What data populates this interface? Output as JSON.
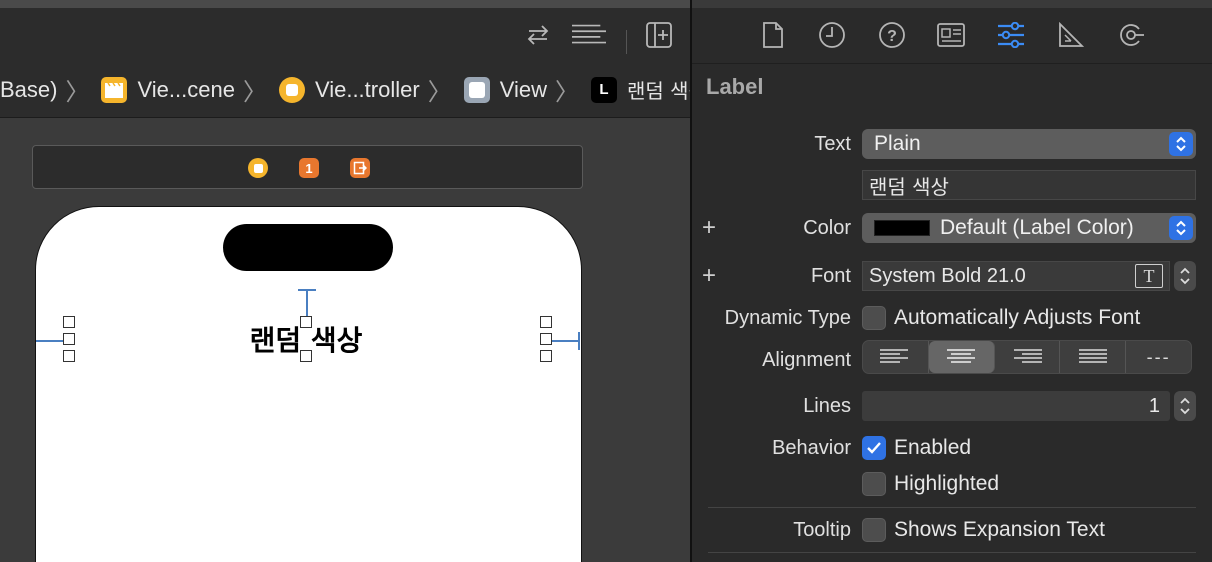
{
  "editor": {
    "breadcrumbs": [
      {
        "label": "Base)",
        "icon": "none"
      },
      {
        "label": "Vie...cene",
        "icon": "scene-icon"
      },
      {
        "label": "Vie...troller",
        "icon": "view-controller-icon"
      },
      {
        "label": "View",
        "icon": "view-icon"
      },
      {
        "label": "랜덤 색상",
        "icon": "label-icon",
        "icon_text": "L"
      }
    ],
    "scene_badge_1": "1",
    "phone_label": "랜덤 색상"
  },
  "inspector": {
    "tabs": [
      "file-icon",
      "history-icon",
      "help-icon",
      "identity-icon",
      "attributes-icon",
      "size-icon",
      "connections-icon"
    ],
    "active_tab": "attributes-icon",
    "section_title": "Label",
    "text": {
      "label": "Text",
      "value": "Plain",
      "content": "랜덤 색상"
    },
    "color": {
      "label": "Color",
      "value": "Default (Label Color)",
      "swatch": "#000000"
    },
    "font": {
      "label": "Font",
      "value": "System Bold 21.0",
      "icon_text": "T"
    },
    "dynamic_type": {
      "label": "Dynamic Type",
      "checkbox_label": "Automatically Adjusts Font",
      "checked": false
    },
    "alignment": {
      "label": "Alignment",
      "options": [
        "left",
        "center",
        "right",
        "justified",
        "natural"
      ],
      "selected": "center",
      "natural_glyph": "---"
    },
    "lines": {
      "label": "Lines",
      "value": "1"
    },
    "behavior": {
      "label": "Behavior",
      "enabled_label": "Enabled",
      "enabled": true,
      "highlighted_label": "Highlighted",
      "highlighted": false
    },
    "tooltip": {
      "label": "Tooltip",
      "checkbox_label": "Shows Expansion Text",
      "checked": false
    }
  },
  "colors": {
    "accent": "#2f72e4",
    "active_tab": "#3b8cf5",
    "scene_yellow": "#f5b52c",
    "scene_orange": "#e8772e"
  }
}
